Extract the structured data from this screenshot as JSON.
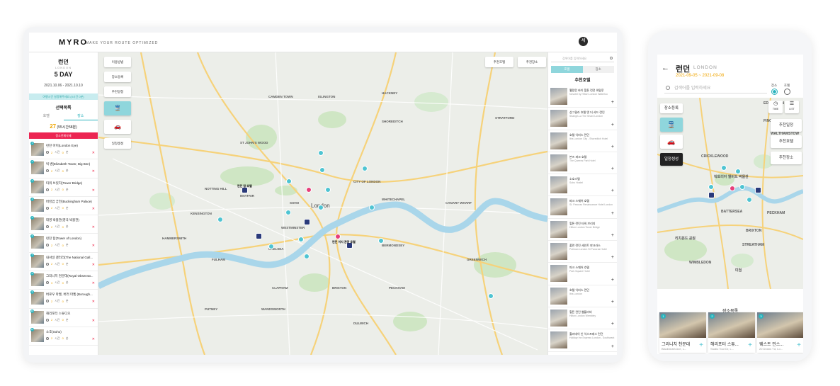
{
  "desktop": {
    "logo": "MYRO",
    "tagline": "MAKE YOUR ROUTE OPTIMIZED",
    "user_initial": "세",
    "left_panel": {
      "city": "런던",
      "city_en": "LONDON",
      "days": "5 DAY",
      "dates": "2021.10.06 - 2021.10.10",
      "banner": "여행시간 설정해주세요 (0시간 0분)",
      "selection_title": "선택목록",
      "tabs": [
        "호텔",
        "장소"
      ],
      "count_num": "27",
      "count_text": "(55시간58분)",
      "reset": "장소전체삭제",
      "items": [
        {
          "num": "1",
          "name": "런던 아이(London Eye)",
          "a": "2",
          "h": "0"
        },
        {
          "num": "2",
          "name": "빅 벤(Elizabeth Tower, Big Ben)",
          "a": "2",
          "h": "0"
        },
        {
          "num": "3",
          "name": "타워 브릿지(Tower Bridge)",
          "a": "2",
          "h": "0"
        },
        {
          "num": "4",
          "name": "버킹엄 궁전(Buckingham Palace)",
          "a": "2",
          "h": "0"
        },
        {
          "num": "5",
          "name": "대영 박물관(영국 박물관)",
          "a": "2",
          "h": "0"
        },
        {
          "num": "6",
          "name": "런던 탑(Tower of London)",
          "a": "2",
          "h": "0"
        },
        {
          "num": "7",
          "name": "내셔널 갤러리(The National Gall...",
          "a": "2",
          "h": "0"
        },
        {
          "num": "8",
          "name": "그리니치 천문대(Royal Observat...",
          "a": "3",
          "h": "0"
        },
        {
          "num": "9",
          "name": "버로우 마켓, 버러 마켓 (Borough...",
          "a": "2",
          "h": "0"
        },
        {
          "num": "10",
          "name": "해리포터 스튜디오",
          "a": "2",
          "h": "0"
        },
        {
          "num": "11",
          "name": "소호(Soho)",
          "a": "2",
          "h": "0"
        }
      ],
      "time_label": "시간",
      "min_label": "분"
    },
    "map": {
      "buttons": [
        "이용방법",
        "장소등록",
        "추천일정",
        "일정생성"
      ],
      "top_buttons": [
        "추천호텔",
        "추천장소"
      ],
      "labels": [
        {
          "text": "London",
          "big": true
        },
        {
          "text": "MAYFAIR"
        },
        {
          "text": "SOHO"
        },
        {
          "text": "WESTMINSTER"
        },
        {
          "text": "CHELSEA"
        },
        {
          "text": "KENSINGTON"
        },
        {
          "text": "CAMDEN TOWN"
        },
        {
          "text": "ISLINGTON"
        },
        {
          "text": "SHOREDITCH"
        },
        {
          "text": "WHITECHAPEL"
        },
        {
          "text": "BERMONDSEY"
        },
        {
          "text": "PECKHAM"
        },
        {
          "text": "BRIXTON"
        },
        {
          "text": "CLAPHAM"
        },
        {
          "text": "GREENWICH"
        },
        {
          "text": "CANARY WHARF"
        },
        {
          "text": "HACKNEY"
        },
        {
          "text": "FULHAM"
        },
        {
          "text": "HAMMERSMITH"
        },
        {
          "text": "NOTTING HILL"
        },
        {
          "text": "ST JOHN'S WOOD"
        },
        {
          "text": "CITY OF LONDON"
        },
        {
          "text": "PUTNEY"
        },
        {
          "text": "WANDSWORTH"
        },
        {
          "text": "DULWICH"
        },
        {
          "text": "STRATFORD"
        }
      ],
      "pin_labels": [
        "런던 탑 호텔",
        "런던 이지 관광 호텔"
      ]
    },
    "right_panel": {
      "search_placeholder": "검색어를 입력하세요",
      "toggle": [
        "호텔",
        "장소"
      ],
      "title": "추천호텔",
      "items": [
        {
          "name": "웰링턴 바이 힐튼 런던 워털루",
          "sub": "Novotel by Hilton London Waterloo"
        },
        {
          "name": "상그릴라 호텔 앳 더 샤드 런던",
          "sub": "Shangri-La The Shard London"
        },
        {
          "name": "호텔 익비스 런던",
          "sub": "Ibis London City - Shoreditch Hotel"
        },
        {
          "name": "본즈 파크 호텔",
          "sub": "The Queens Park Hotel"
        },
        {
          "name": "소호스텔",
          "sub": "Soho Hostel"
        },
        {
          "name": "파크 스퀘어 호텔",
          "sub": "St. Pancras Renaissance Hotel London"
        },
        {
          "name": "힐튼 런던 타워 브리지",
          "sub": "Hilton London Tower Bridge"
        },
        {
          "name": "풀먼 런던 세인트 판크라스",
          "sub": "Pullman London St Pancras Hotel"
        },
        {
          "name": "파크 스퀘어 호텔",
          "sub": "Park Square Hotel"
        },
        {
          "name": "호텔 익비스 런던",
          "sub": "Ibis London"
        },
        {
          "name": "힐튼 런던 웹블리비",
          "sub": "Hilton London Wembley"
        },
        {
          "name": "홀리데이 인 익스프레스 런던",
          "sub": "Holiday Inn Express London - Southwark"
        }
      ]
    }
  },
  "phone": {
    "city": "런던",
    "city_en": "LONDON",
    "dates": "2021-09-05 ~ 2021-09-08",
    "search_placeholder": "검색어를 입력하세요",
    "radio_place": "장소",
    "radio_hotel": "호텔",
    "buttons": {
      "register": "장소등록",
      "create": "일정생성",
      "rec_schedule": "추천일정",
      "rec_hotel": "추천호텔",
      "rec_place": "추천장소",
      "time": "TIME",
      "list": "LIST"
    },
    "map_labels": [
      "FINCHLEY",
      "EDMONTON",
      "WALTHAMSTOW",
      "HACKNEY",
      "CRICKLEWOOD",
      "빅토리아 앨버트 박물관",
      "BATTERSEA",
      "PECKHAM",
      "BRIXTON",
      "STREATHAM",
      "WIMBLEDON",
      "리치몬드 공원",
      "미첨"
    ],
    "bottom_title": "장소목록",
    "cards": [
      {
        "num": "1",
        "name": "그리니치 천문대",
        "sub": "Blackheath Ave, L..."
      },
      {
        "num": "2",
        "name": "해리포터 스튜...",
        "sub": "Studio Tour Dr, L..."
      },
      {
        "num": "3",
        "name": "웨스트 민스...",
        "sub": "20 Deans Yd, Lo..."
      }
    ]
  }
}
